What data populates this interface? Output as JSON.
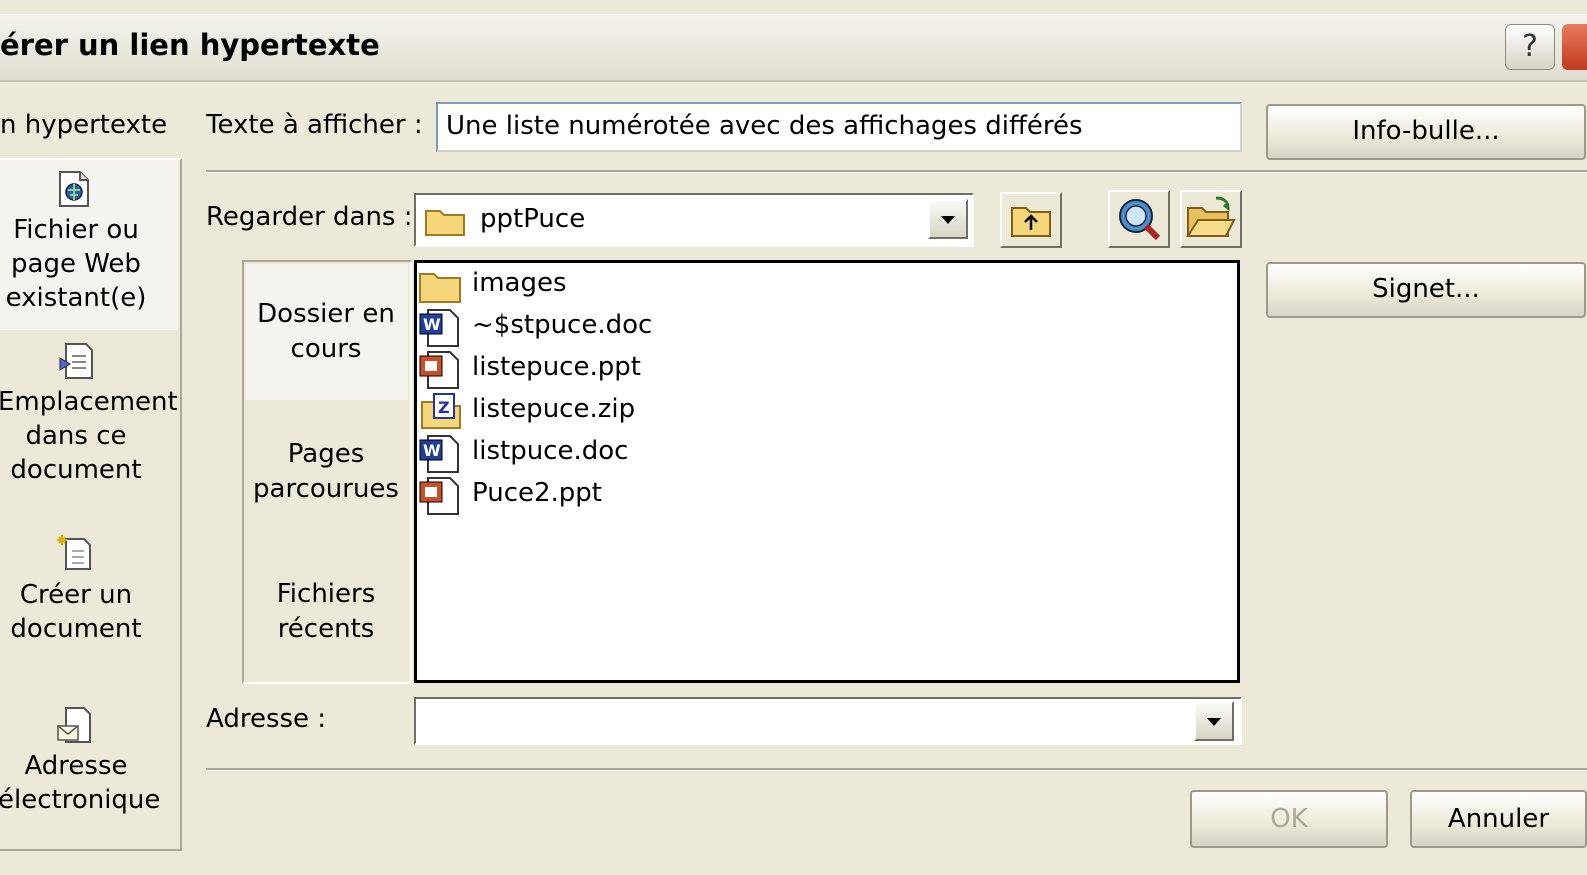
{
  "window": {
    "title": "érer un lien hypertexte",
    "help_label": "?"
  },
  "link_to": {
    "header": "n hypertexte",
    "items": [
      {
        "lines": [
          "Fichier ou",
          "page Web",
          "existant(e)"
        ],
        "icon": "web-page-file-icon",
        "selected": true
      },
      {
        "lines": [
          "Emplacement",
          "dans ce",
          "document"
        ],
        "icon": "place-in-document-icon"
      },
      {
        "lines": [
          "Créer un",
          "document"
        ],
        "icon": "new-document-icon"
      },
      {
        "lines": [
          "Adresse",
          "électronique"
        ],
        "icon": "email-address-icon"
      }
    ]
  },
  "text_to_display": {
    "label": "Texte à afficher :",
    "value": "Une liste numérotée avec des affichages différés"
  },
  "look_in": {
    "label": "Regarder dans :",
    "value": "pptPuce"
  },
  "places": [
    {
      "lines": [
        "Dossier en",
        "cours"
      ]
    },
    {
      "lines": [
        "Pages",
        "parcourues"
      ]
    },
    {
      "lines": [
        "Fichiers",
        "récents"
      ]
    }
  ],
  "files": [
    {
      "name": "images",
      "type": "folder"
    },
    {
      "name": "~$stpuce.doc",
      "type": "word"
    },
    {
      "name": "listepuce.ppt",
      "type": "powerpoint"
    },
    {
      "name": "listepuce.zip",
      "type": "zip"
    },
    {
      "name": "listpuce.doc",
      "type": "word"
    },
    {
      "name": "Puce2.ppt",
      "type": "powerpoint"
    }
  ],
  "address": {
    "label": "Adresse :",
    "value": ""
  },
  "buttons": {
    "tooltip": "Info-bulle...",
    "bookmark": "Signet...",
    "ok": "OK",
    "cancel": "Annuler"
  }
}
